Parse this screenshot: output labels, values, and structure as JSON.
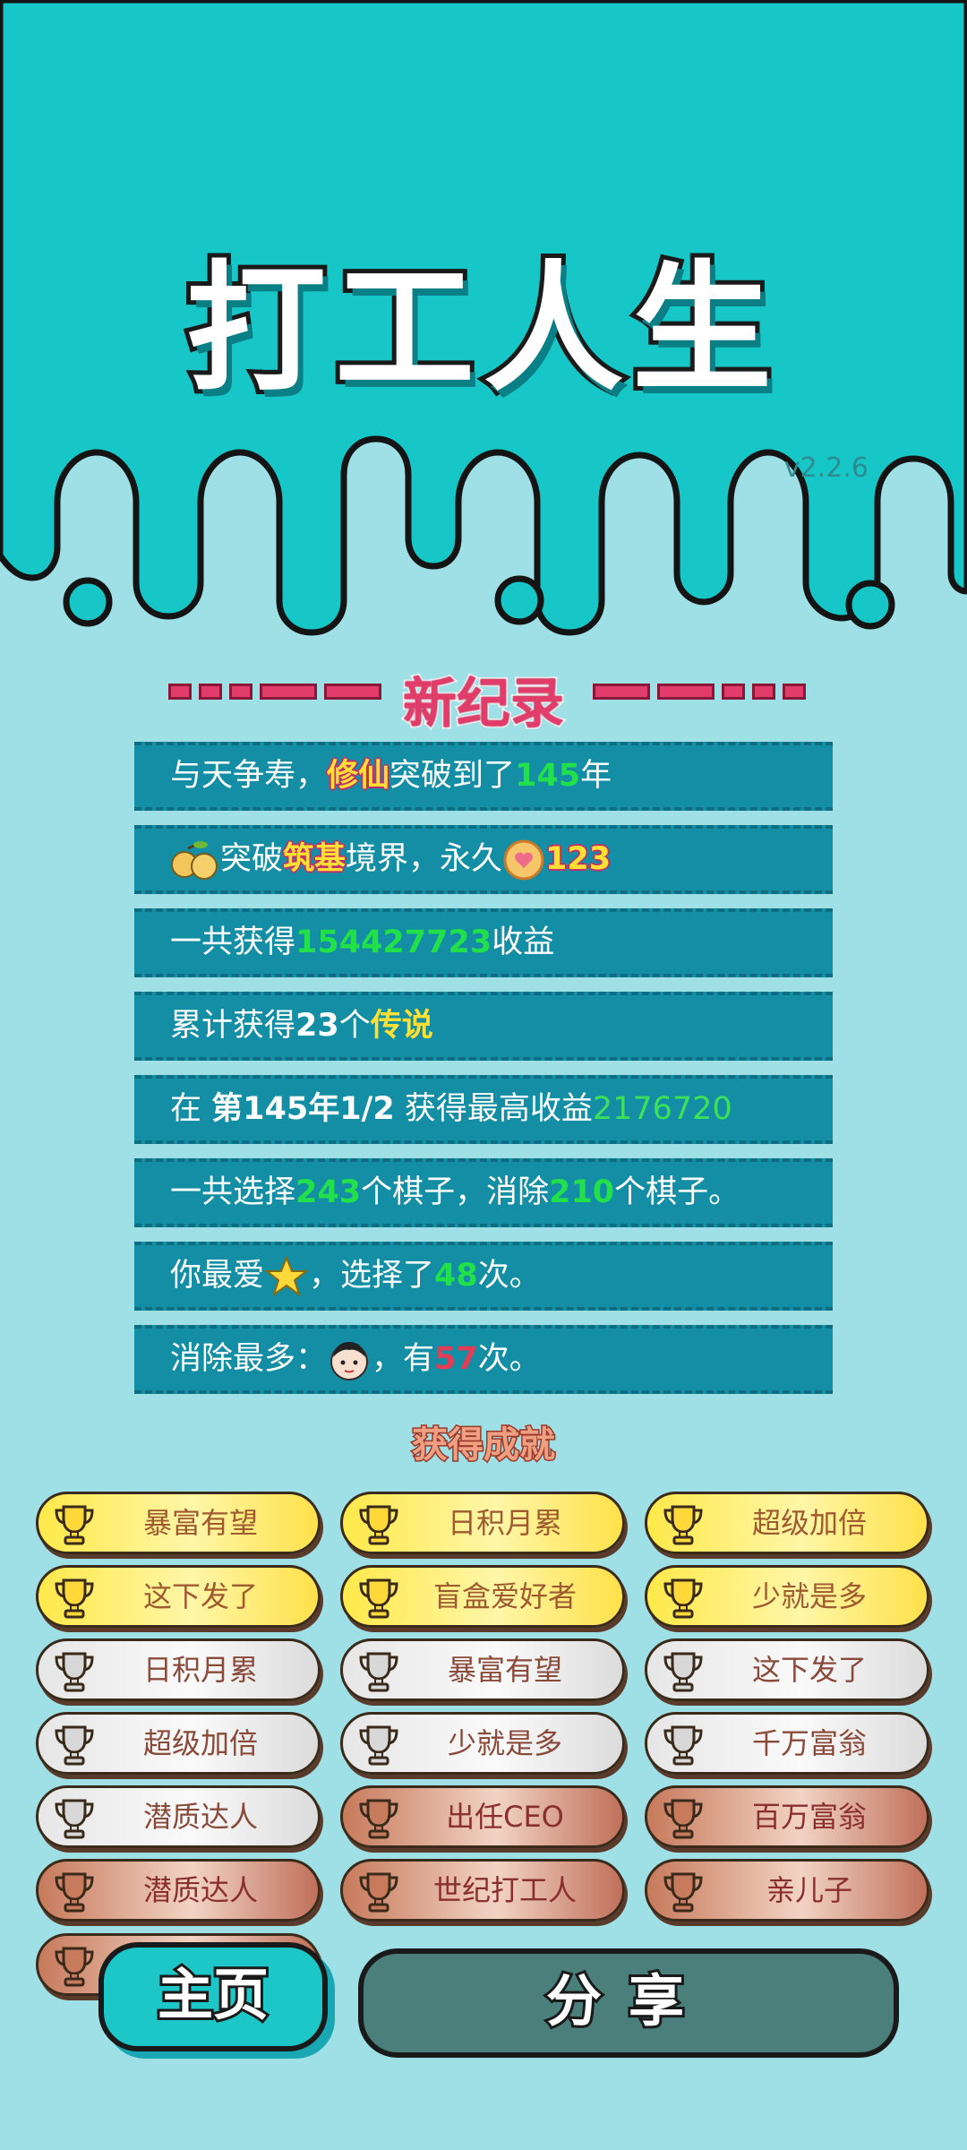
{
  "app": {
    "title": "打工人生",
    "version": "v2.2.6"
  },
  "records_header": {
    "title": "新纪录"
  },
  "records": {
    "r1": {
      "a": "与天争寿，",
      "b": "修仙",
      "c": "突破到了",
      "d": "145",
      "e": "年"
    },
    "r2": {
      "a": "突破",
      "b": "筑基",
      "c": "境界，永久",
      "d": "123"
    },
    "r3": {
      "a": "一共获得",
      "b": "154427723",
      "c": "收益"
    },
    "r4": {
      "a": "累计获得",
      "b": "23",
      "c": "个",
      "d": "传说"
    },
    "r5": {
      "a": "在 ",
      "b": "第145年1/2",
      "c": " 获得最高收益",
      "d": "2176720"
    },
    "r6": {
      "a": "一共选择",
      "b": "243",
      "c": "个棋子，消除",
      "d": "210",
      "e": "个棋子。"
    },
    "r7": {
      "a": "你最爱",
      "b": "，选择了",
      "c": "48",
      "d": "次。"
    },
    "r8": {
      "a": "消除最多：",
      "b": "，有",
      "c": "57",
      "d": "次。"
    }
  },
  "achievements_header": {
    "title": "获得成就"
  },
  "achievements": [
    {
      "label": "暴富有望",
      "tier": "gold"
    },
    {
      "label": "日积月累",
      "tier": "gold"
    },
    {
      "label": "超级加倍",
      "tier": "gold"
    },
    {
      "label": "这下发了",
      "tier": "gold"
    },
    {
      "label": "盲盒爱好者",
      "tier": "gold"
    },
    {
      "label": "少就是多",
      "tier": "gold"
    },
    {
      "label": "日积月累",
      "tier": "silver"
    },
    {
      "label": "暴富有望",
      "tier": "silver"
    },
    {
      "label": "这下发了",
      "tier": "silver"
    },
    {
      "label": "超级加倍",
      "tier": "silver"
    },
    {
      "label": "少就是多",
      "tier": "silver"
    },
    {
      "label": "千万富翁",
      "tier": "silver"
    },
    {
      "label": "潜质达人",
      "tier": "silver"
    },
    {
      "label": "出任CEO",
      "tier": "bronze"
    },
    {
      "label": "百万富翁",
      "tier": "bronze"
    },
    {
      "label": "潜质达人",
      "tier": "bronze"
    },
    {
      "label": "世纪打工人",
      "tier": "bronze"
    },
    {
      "label": "亲儿子",
      "tier": "bronze"
    }
  ],
  "buttons": {
    "home": "主页",
    "share": "分享"
  },
  "colors": {
    "header": "#17c6c6",
    "page": "#9fdfe6",
    "record_row": "#138ea4",
    "accent_pink": "#e23d6a",
    "value_green": "#22e04a"
  }
}
